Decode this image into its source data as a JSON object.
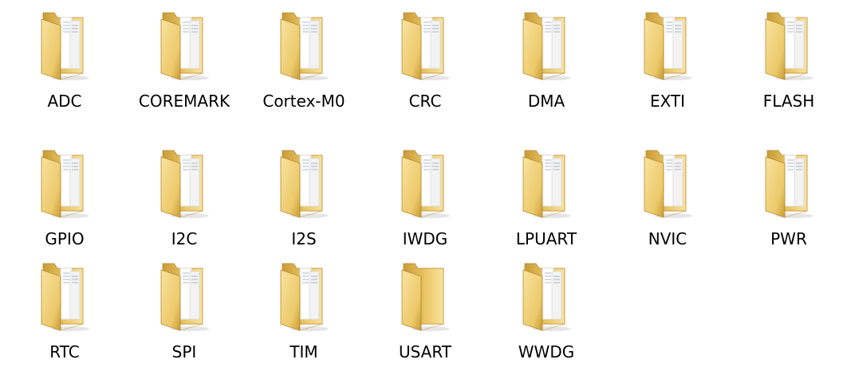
{
  "folders": [
    {
      "label": "ADC",
      "icon": "folder-with-files-icon"
    },
    {
      "label": "COREMARK",
      "icon": "folder-with-files-icon"
    },
    {
      "label": "Cortex-M0",
      "icon": "folder-with-files-icon"
    },
    {
      "label": "CRC",
      "icon": "folder-with-files-icon"
    },
    {
      "label": "DMA",
      "icon": "folder-with-files-icon"
    },
    {
      "label": "EXTI",
      "icon": "folder-with-files-icon"
    },
    {
      "label": "FLASH",
      "icon": "folder-with-files-icon"
    },
    {
      "label": "GPIO",
      "icon": "folder-with-files-icon"
    },
    {
      "label": "I2C",
      "icon": "folder-with-files-icon"
    },
    {
      "label": "I2S",
      "icon": "folder-with-files-icon"
    },
    {
      "label": "IWDG",
      "icon": "folder-with-files-icon"
    },
    {
      "label": "LPUART",
      "icon": "folder-with-files-icon"
    },
    {
      "label": "NVIC",
      "icon": "folder-with-files-icon"
    },
    {
      "label": "PWR",
      "icon": "folder-with-files-icon"
    },
    {
      "label": "RTC",
      "icon": "folder-with-files-icon"
    },
    {
      "label": "SPI",
      "icon": "folder-with-files-icon"
    },
    {
      "label": "TIM",
      "icon": "folder-with-files-icon"
    },
    {
      "label": "USART",
      "icon": "folder-empty-icon"
    },
    {
      "label": "WWDG",
      "icon": "folder-with-files-icon"
    }
  ],
  "colors": {
    "folder_light": "#f9e3a0",
    "folder_mid": "#ecc96a",
    "folder_dark": "#c89b36",
    "paper": "#ffffff",
    "paper_edge": "#d8d8d8",
    "text": "#000000"
  }
}
